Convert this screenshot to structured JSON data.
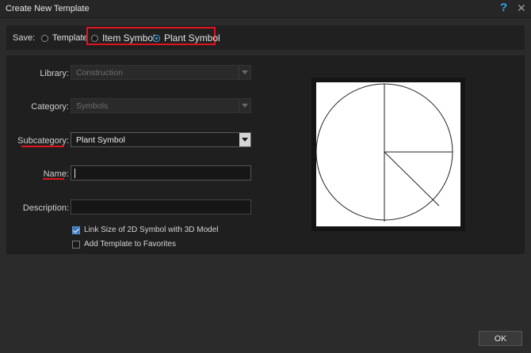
{
  "window": {
    "title": "Create New Template"
  },
  "save": {
    "label": "Save:",
    "options": [
      {
        "label": "Template",
        "selected": false
      },
      {
        "label": "Item Symbol",
        "selected": false
      },
      {
        "label": "Plant Symbol",
        "selected": true
      }
    ]
  },
  "form": {
    "library_label": "Library:",
    "library_value": "Construction",
    "category_label": "Category:",
    "category_value": "Symbols",
    "subcategory_label": "Subcategory:",
    "subcategory_value": "Plant Symbol",
    "name_label": "Name:",
    "name_value": "",
    "description_label": "Description:",
    "description_value": ""
  },
  "options": {
    "link_size_label": "Link Size of 2D Symbol with 3D Model",
    "link_size_checked": true,
    "favorites_label": "Add Template to Favorites",
    "favorites_checked": false
  },
  "buttons": {
    "ok_label": "OK"
  },
  "colors": {
    "highlight": "#e0141e",
    "accent": "#2aa7f0"
  },
  "icons": {
    "help": "help-icon",
    "close": "close-icon"
  }
}
